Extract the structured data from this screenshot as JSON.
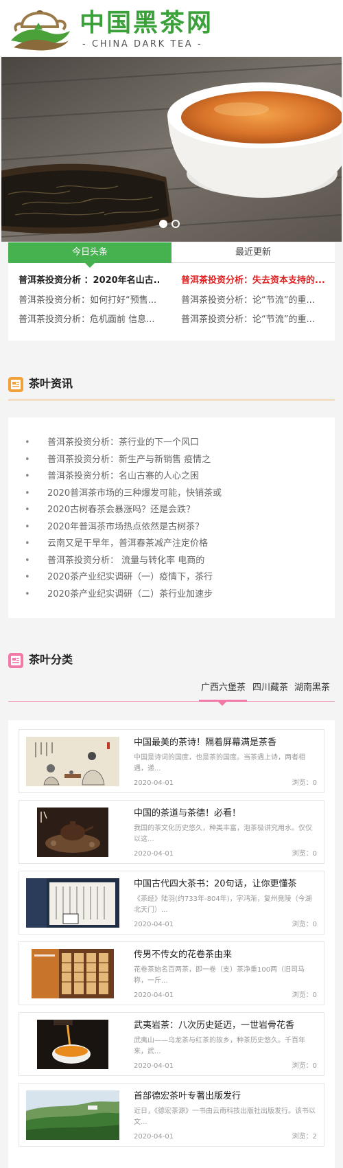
{
  "header": {
    "logo_cn": "中国黑茶网",
    "logo_en": "- CHINA DARK TEA -"
  },
  "banner": {
    "slide_count": 2,
    "active_slide": 1
  },
  "headlines": {
    "tabs": [
      {
        "label": "今日头条",
        "active": true
      },
      {
        "label": "最近更新",
        "active": false
      }
    ],
    "left": [
      "普洱茶投资分析 ：2020年名山古...",
      "普洱茶投资分析：如何打好“预售...",
      "普洱茶投资分析：危机面前 信息..."
    ],
    "right": [
      "普洱茶投资分析：失去资本支持的...",
      "普洱茶投资分析：论“节流”的重...",
      "普洱茶投资分析：论“节流”的重..."
    ]
  },
  "tea_news": {
    "title": "茶叶资讯",
    "items": [
      "普洱茶投资分析：茶行业的下一个风口",
      "普洱茶投资分析：新生产与新销售 疫情之",
      "普洱茶投资分析：名山古寨的人心之困",
      "2020普洱茶市场的三种爆发可能，快销茶或",
      "2020古树春茶会暴涨吗？还是会跌？",
      "2020年普洱茶市场热点依然是古树茶？",
      "云南又是干旱年，普洱春茶减产注定价格",
      "普洱茶投资分析： 流量与转化率 电商的",
      "2020茶产业纪实调研（一）疫情下，茶行",
      "2020茶产业纪实调研（二）茶行业加速步"
    ]
  },
  "tea_category": {
    "title": "茶叶分类",
    "tabs": [
      {
        "label": "广西六堡茶",
        "active": true
      },
      {
        "label": "四川藏茶",
        "active": false
      },
      {
        "label": "湖南黑茶",
        "active": false
      }
    ],
    "articles": [
      {
        "title": "中国最美的茶诗！隔着屏幕满是茶香",
        "desc": "中国是诗词的国度，也是茶的国度。当茶遇上诗，两者相遇，递...",
        "date": "2020-04-01",
        "views": "浏览：0",
        "thumb": "painting"
      },
      {
        "title": "中国的茶道与茶德！必看！",
        "desc": "我国的茶文化历史悠久，种类丰富，泡茶极讲究用水。仅仅以这...",
        "date": "2020-04-01",
        "views": "浏览：0",
        "thumb": "teapot"
      },
      {
        "title": "中国古代四大茶书：20句话，让你更懂茶",
        "desc": "《茶经》陆羽(约733年-804年)，字鸿渐，复州竟陵（今湖北天门）...",
        "date": "2020-04-01",
        "views": "浏览：0",
        "thumb": "book"
      },
      {
        "title": "传男不传女的花卷茶由来",
        "desc": "花卷茶始名百两茶，即一卷（支）茶净重100两（旧司马称，一斤...",
        "date": "2020-04-01",
        "views": "浏览：0",
        "thumb": "rolls"
      },
      {
        "title": "武夷岩茶：八次历史延迈，一世岩骨花香",
        "desc": "武夷山——乌龙茶与红茶的故乡，种茶历史悠久。千百年来，武...",
        "date": "2020-04-01",
        "views": "浏览：0",
        "thumb": "pour"
      },
      {
        "title": "首部德宏茶叶专著出版发行",
        "desc": "近日，《德宏茶源》一书由云南科技出版社出版发行。该书以文...",
        "date": "2020-04-01",
        "views": "浏览：2",
        "thumb": "hills"
      }
    ]
  },
  "colors": {
    "brand_green": "#3aa039",
    "tab_green": "#46b14f",
    "headline_red": "#e02020",
    "news_accent": "#f0a13b",
    "category_accent": "#f17aa8"
  }
}
